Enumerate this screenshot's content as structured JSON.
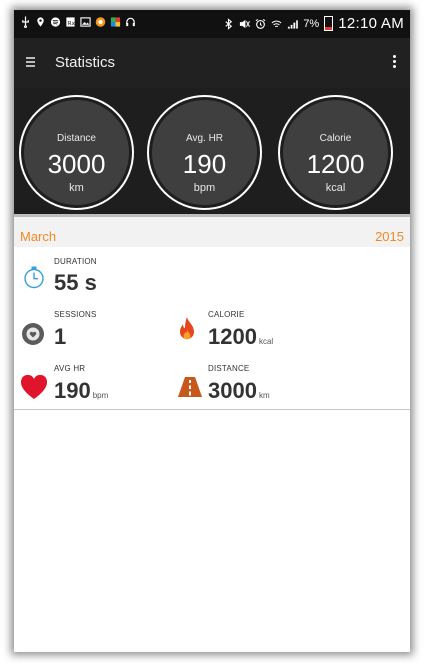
{
  "statusbar": {
    "battery": "7%",
    "time": "12:10 AM"
  },
  "appbar": {
    "title": "Statistics"
  },
  "summary": [
    {
      "label": "Distance",
      "value": "3000",
      "unit": "km"
    },
    {
      "label": "Avg. HR",
      "value": "190",
      "unit": "bpm"
    },
    {
      "label": "Calorie",
      "value": "1200",
      "unit": "kcal"
    }
  ],
  "period": {
    "month": "March",
    "year": "2015"
  },
  "details": {
    "duration": {
      "label": "DURATION",
      "value": "55 s"
    },
    "sessions": {
      "label": "SESSIONS",
      "value": "1"
    },
    "calorie": {
      "label": "CALORIE",
      "value": "1200",
      "unit": "kcal"
    },
    "avg_hr": {
      "label": "AVG HR",
      "value": "190",
      "unit": "bpm"
    },
    "distance": {
      "label": "DISTANCE",
      "value": "3000",
      "unit": "km"
    }
  },
  "colors": {
    "accent": "#f08a24",
    "heart": "#e0142b",
    "timer": "#3aa0d8",
    "fire": "#e5451f",
    "road": "#c8571c"
  },
  "icons": [
    "timer-icon",
    "sessions-icon",
    "fire-icon",
    "heart-icon",
    "road-icon"
  ]
}
